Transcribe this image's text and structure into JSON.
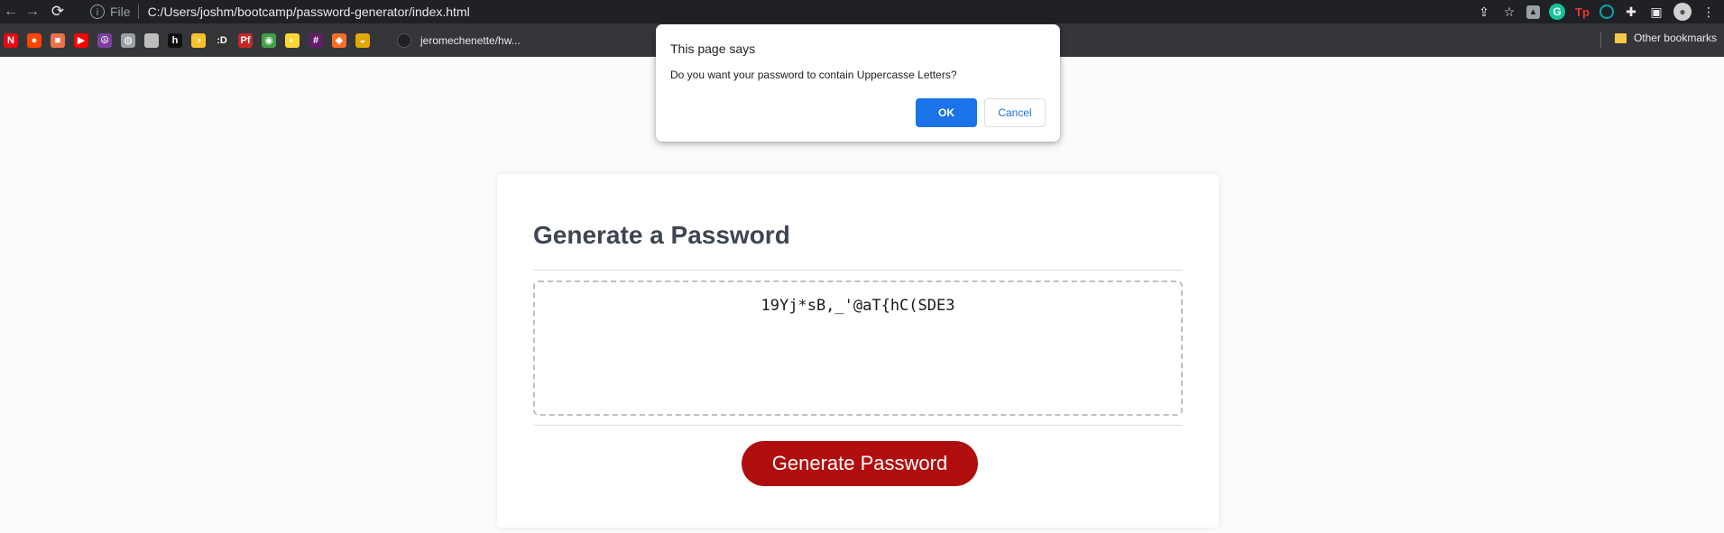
{
  "browser": {
    "address": {
      "scheme_label": "File",
      "url": "C:/Users/joshm/bootcamp/password-generator/index.html"
    },
    "bookmarks": {
      "items": [
        {
          "name": "netflix",
          "glyph": "N",
          "color": "#e50914"
        },
        {
          "name": "reddit",
          "glyph": "●",
          "color": "#ff4500"
        },
        {
          "name": "bookmark-3",
          "glyph": "■",
          "color": "#e8734a"
        },
        {
          "name": "youtube",
          "glyph": "▶",
          "color": "#ff0000"
        },
        {
          "name": "bookmark-5",
          "glyph": "☮",
          "color": "#7b3fa0"
        },
        {
          "name": "globe",
          "glyph": "◍",
          "color": "#9aa0a6"
        },
        {
          "name": "apple",
          "glyph": "",
          "color": "#bdbdbd"
        },
        {
          "name": "bookmark-h",
          "glyph": "h",
          "color": "#111111"
        },
        {
          "name": "bookmark-9",
          "glyph": "◑",
          "color": "#fbc02d"
        },
        {
          "name": "bookmark-d",
          "glyph": ":D",
          "color": "#333333"
        },
        {
          "name": "bookmark-pf",
          "glyph": "Pf",
          "color": "#c62828"
        },
        {
          "name": "bookmark-12",
          "glyph": "◉",
          "color": "#43a047"
        },
        {
          "name": "bookmark-13",
          "glyph": "◐",
          "color": "#fdd835"
        },
        {
          "name": "slack",
          "glyph": "#",
          "color": "#611f69"
        },
        {
          "name": "gitlab",
          "glyph": "◆",
          "color": "#fc6d26"
        },
        {
          "name": "bookmark-16",
          "glyph": "◒",
          "color": "#e0a800"
        }
      ],
      "github_label": "jeromechenette/hw...",
      "other_label": "Other bookmarks"
    }
  },
  "page": {
    "title": "Generate a Password",
    "password": "19Yj*sB,_'@aT{hC(SDE3",
    "generate_label": "Generate Password"
  },
  "dialog": {
    "title": "This page says",
    "message": "Do you want your password to contain Uppercasse Letters?",
    "ok_label": "OK",
    "cancel_label": "Cancel"
  },
  "colors": {
    "button_red": "#b00e0e",
    "dialog_blue": "#1a73e8"
  }
}
